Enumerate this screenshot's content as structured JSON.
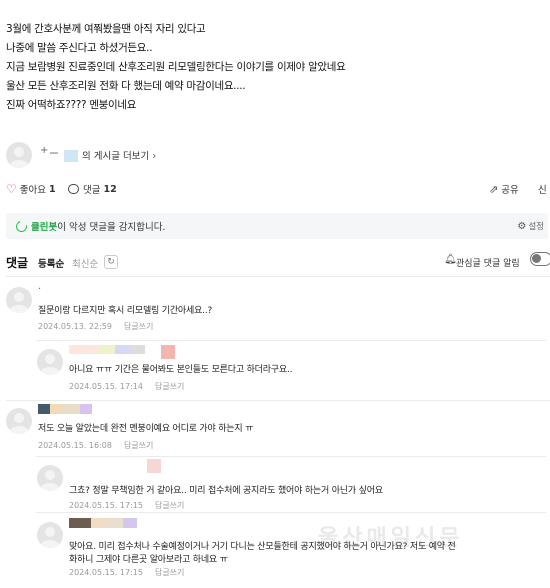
{
  "post": {
    "lines": [
      "3월에 간호사분께 여쭤봤을땐 아직 자리 있다고",
      "나중에 말씀 주신다고 하셨거든요..",
      "지금 보람병원 진료중인데 산후조리원 리모델링한다는 이야기를 이제야 알았네요",
      "울산 모든 산후조리원 전화 다 했는데 예약 마감이네요....",
      "진짜 어떡하죠???? 멘붕이네요"
    ]
  },
  "author": {
    "prefix": "+",
    "more_posts_label": "의 게시글 더보기"
  },
  "actions": {
    "like_label": "좋아요",
    "like_count": "1",
    "comment_label": "댓글",
    "comment_count": "12",
    "share_label": "공유",
    "extra_label": "신"
  },
  "cleanbot": {
    "name": "클린봇",
    "message": "이 악성 댓글을 감지합니다.",
    "settings_label": "설정"
  },
  "comment_header": {
    "title": "댓글",
    "sort_registered": "등록순",
    "sort_latest": "최신순",
    "refresh_icon": "↻",
    "notify_label": "관심글 댓글 알림"
  },
  "comments": [
    {
      "nick_prefix": ".",
      "text": "질문이랑 다르지만 혹시 리모델링 기간아세요..?",
      "date": "2024.05.13. 22:59",
      "reply_label": "답글쓰기"
    },
    {
      "nick_prefix": "",
      "text": "아니요 ㅠㅠ 기간은 물어봐도 본인들도 모른다고 하더라구요..",
      "date": "2024.05.15. 17:14",
      "reply_label": "답글쓰기"
    },
    {
      "nick_prefix": "",
      "text": "저도 오늘 알았는데 완전 멘붕이예요 어디로 가야 하는지 ㅠ",
      "date": "2024.05.15. 16:08",
      "reply_label": "답글쓰기"
    },
    {
      "nick_prefix": "",
      "text": "그쵸? 정말 무책임한 거 같아요.. 미리 접수처에 공지라도 했어야 하는거 아닌가 싶어요",
      "date": "2024.05.15. 17:15",
      "reply_label": "답글쓰기"
    },
    {
      "nick_prefix": "",
      "text": "맞아요. 미리 접수처나 수술예정이거나 거기 다니는 산모들한테 공지했어야 하는거 아닌가요? 저도 예약 전",
      "text2": "화하니 그제야 다른곳 알아보라고 하네요 ㅠ",
      "date": "2024.05.15. 17:15",
      "reply_label": "답글쓰기"
    }
  ],
  "watermark": "울산매일신문",
  "colors": {
    "heart": "#e0454f",
    "cleanbot_green": "#1fa846",
    "meta_gray": "#999999"
  }
}
